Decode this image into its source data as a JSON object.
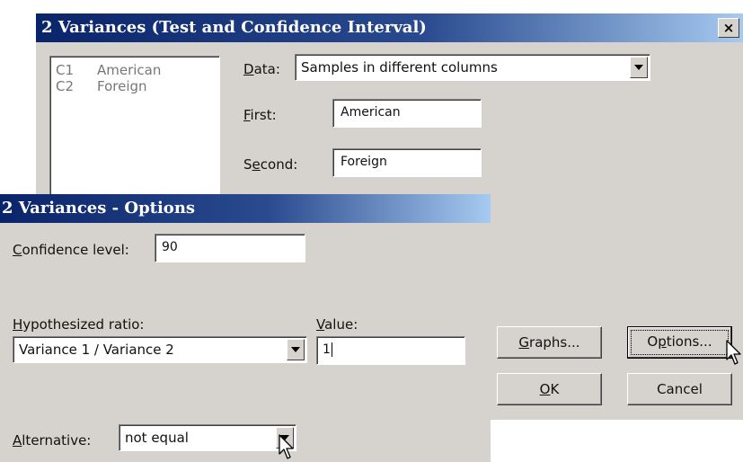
{
  "main_dialog": {
    "title": "2 Variances (Test and Confidence Interval)",
    "close_label": "×",
    "variables": [
      {
        "id": "C1",
        "name": "American"
      },
      {
        "id": "C2",
        "name": "Foreign"
      }
    ],
    "data_label_prefix": "",
    "data_label_access": "D",
    "data_label_rest": "ata:",
    "data_value": "Samples in different columns",
    "first_label_access": "F",
    "first_label_rest": "irst:",
    "first_value": "American",
    "second_label_pre": "S",
    "second_label_access": "e",
    "second_label_rest": "cond:",
    "second_value": "Foreign",
    "graphs_access": "G",
    "graphs_rest": "raphs...",
    "options_pre": "O",
    "options_access": "p",
    "options_rest": "tions...",
    "ok_access": "O",
    "ok_rest": "K",
    "cancel_label": "Cancel"
  },
  "options_dialog": {
    "title": "2 Variances - Options",
    "confidence_access": "C",
    "confidence_rest": "onfidence level:",
    "confidence_value": "90",
    "hyp_access": "H",
    "hyp_rest": "ypothesized ratio:",
    "hyp_value": "Variance 1 / Variance 2",
    "value_access": "V",
    "value_rest": "alue:",
    "value_value": "1",
    "alt_access": "A",
    "alt_rest": "lternative:",
    "alt_value": "not equal"
  }
}
